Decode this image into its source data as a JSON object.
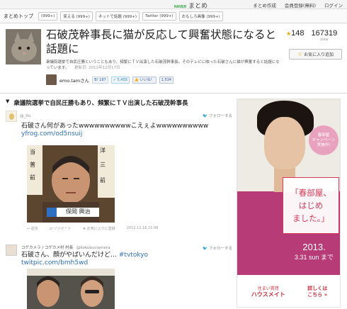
{
  "topbar": {
    "logo_naver": "NAVER",
    "logo_matome": "まとめ",
    "links": [
      "まとめ作成",
      "会員登録(無料)",
      "ログイン"
    ]
  },
  "nav": {
    "home": "まとめトップ",
    "tabs": [
      "(999+)",
      "笑える (999+)",
      "ネットで話題 (999+)",
      "Twitter (999+)",
      "おもしろ画像 (999+)"
    ]
  },
  "article": {
    "title": "石破茂幹事長に猫が反応して興奮状態になると話題に",
    "description": "衆議院選挙で自民圧勝ということもあり、頻繁にＴＶ出演した石破茂幹事長。そのテレビに映った石破さんに猫が興奮すると話題になっています。",
    "updated": "更新日: 2012年12月17日",
    "author": "emo.tam",
    "author_suffix": "さん",
    "stats": {
      "favorites": "148",
      "views": "167319",
      "views_label": "view"
    },
    "favorite_button": "お気に入り追加",
    "share": {
      "hatena": "187",
      "tweet": "5,458",
      "like": "いいね！",
      "like_count": "1,534"
    }
  },
  "section": {
    "heading": "衆議院選挙で自民圧勝もあり、頻繁にＴＶ出演した石破茂幹事長"
  },
  "tweets": [
    {
      "handle": "@_0u",
      "follow": "フォローする",
      "text": "石破さん何があったwwwwwwwwwwこえぇよwwwwwwwwww",
      "link": "yfrog.com/od5nsuij",
      "photo_caption": "保岡 興治",
      "actions": [
        "返信",
        "リツイート",
        "お気に入りに登録"
      ],
      "timestamp": "2012.12.16 21:08"
    },
    {
      "user": "コゲカメラ / コゲカメ村 村長",
      "handle": "@kokubuclamera",
      "follow": "フォローする",
      "text": "石破さん、顔がやばいんだけど…",
      "hashtag": "#tvtokyo",
      "link": "twitpic.com/bmh5wd"
    }
  ],
  "ad": {
    "badge": "春部屋\nキャンペーン\n実施中!",
    "headline_lines": [
      "「春部屋、",
      "はじめ",
      "ました。」"
    ],
    "date_main": "2013.",
    "date_sub": "3.31 sun まで",
    "logo_small": "住まい賃貸",
    "logo_big": "ハウスメイト",
    "cta": "詳しくは\nこちら »"
  }
}
